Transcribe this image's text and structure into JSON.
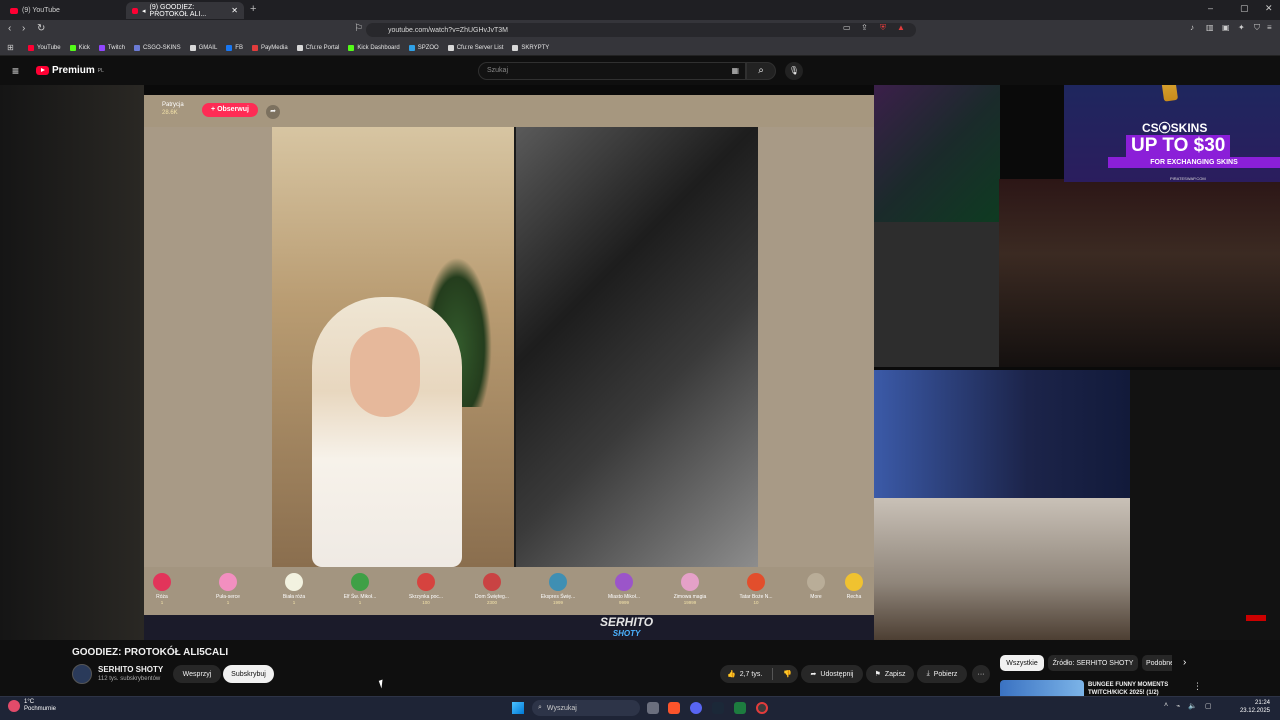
{
  "browser": {
    "tabs": [
      {
        "label": "(9) YouTube"
      },
      {
        "label": "(9) GOODIEZ: PROTOKÓŁ ALI..."
      }
    ],
    "new_tab_glyph": "+",
    "window_controls": [
      "–",
      "▢",
      "✕"
    ],
    "url": "youtube.com/watch?v=ZhUGHvJvT3M",
    "bookmarks": [
      {
        "label": "YouTube",
        "color": "#ff0033"
      },
      {
        "label": "Kick",
        "color": "#53fc18"
      },
      {
        "label": "Twitch",
        "color": "#9146ff"
      },
      {
        "label": "CSGO-SKINS",
        "color": "#6b7bd6"
      },
      {
        "label": "GMAIL",
        "color": "#d8d8d8"
      },
      {
        "label": "FB",
        "color": "#1877f2"
      },
      {
        "label": "PayMedia",
        "color": "#e23c3c"
      },
      {
        "label": "Cfu:re Portal",
        "color": "#d8d8d8"
      },
      {
        "label": "Kick Dashboard",
        "color": "#53fc18"
      },
      {
        "label": "SPZOO",
        "color": "#2fa0e6"
      },
      {
        "label": "Cfu:re Server List",
        "color": "#d8d8d8"
      },
      {
        "label": "SKRYPTY",
        "color": "#d8d8d8"
      }
    ]
  },
  "youtube": {
    "logo_text": "Premium",
    "logo_region": "PL",
    "search_placeholder": "Szukaj"
  },
  "stream": {
    "tiktok_user": "Patrycja",
    "tiktok_likes": "28.6K",
    "follow_label": "+ Obserwuj",
    "gifts": [
      {
        "name": "Róża",
        "price": "1",
        "color": "#e2345a"
      },
      {
        "name": "Puła-serce",
        "price": "1",
        "color": "#f28fc0"
      },
      {
        "name": "Biała róża",
        "price": "1",
        "color": "#f2f2e0"
      },
      {
        "name": "Elf Św. Mikoł...",
        "price": "1",
        "color": "#3fa046"
      },
      {
        "name": "Skrzynka poc...",
        "price": "100",
        "color": "#d6433f"
      },
      {
        "name": "Dom Święteg...",
        "price": "2300",
        "color": "#c94343"
      },
      {
        "name": "Ekspres Świę...",
        "price": "1999",
        "color": "#3f8fb3"
      },
      {
        "name": "Miasto Mikoł...",
        "price": "9999",
        "color": "#9b55c9"
      },
      {
        "name": "Zimowa magia",
        "price": "19999",
        "color": "#e5a1c8"
      },
      {
        "name": "Tatar Boże N...",
        "price": "10",
        "color": "#e24e2c"
      },
      {
        "name": "More",
        "price": "",
        "color": "#b9ad98"
      }
    ],
    "gift_extra": "Recha",
    "overlay_brand": "SERHITO",
    "overlay_brand_sub": "SHOTY",
    "ad_brand": "CS⦿SKINS",
    "ad_headline": "UP TO $30",
    "ad_sub": "FOR EXCHANGING SKINS",
    "ad_url": "PIRATESWAP.COM"
  },
  "video": {
    "title": "GOODIEZ: PROTOKÓŁ ALI5CALI",
    "channel": "SERHITO SHOTY",
    "subscribers": "112 tys. subskrybentów",
    "support_label": "Wesprzyj",
    "subscribe_label": "Subskrybuj",
    "likes": "2,7 tys.",
    "share_label": "Udostępnij",
    "save_label": "Zapisz",
    "download_label": "Pobierz",
    "more_glyph": "···"
  },
  "sidebar": {
    "chips": [
      "Wszystkie",
      "Źródło: SERHITO SHOTY",
      "Podobne"
    ],
    "rec_title": "BUNGEE FUNNY MOMENTS TWITCH/KICK 2025! (1/2)"
  },
  "taskbar": {
    "temperature": "1°C",
    "weather": "Pochmurnie",
    "search_label": "Wyszukaj",
    "time": "21:24",
    "date": "23.12.2025"
  }
}
